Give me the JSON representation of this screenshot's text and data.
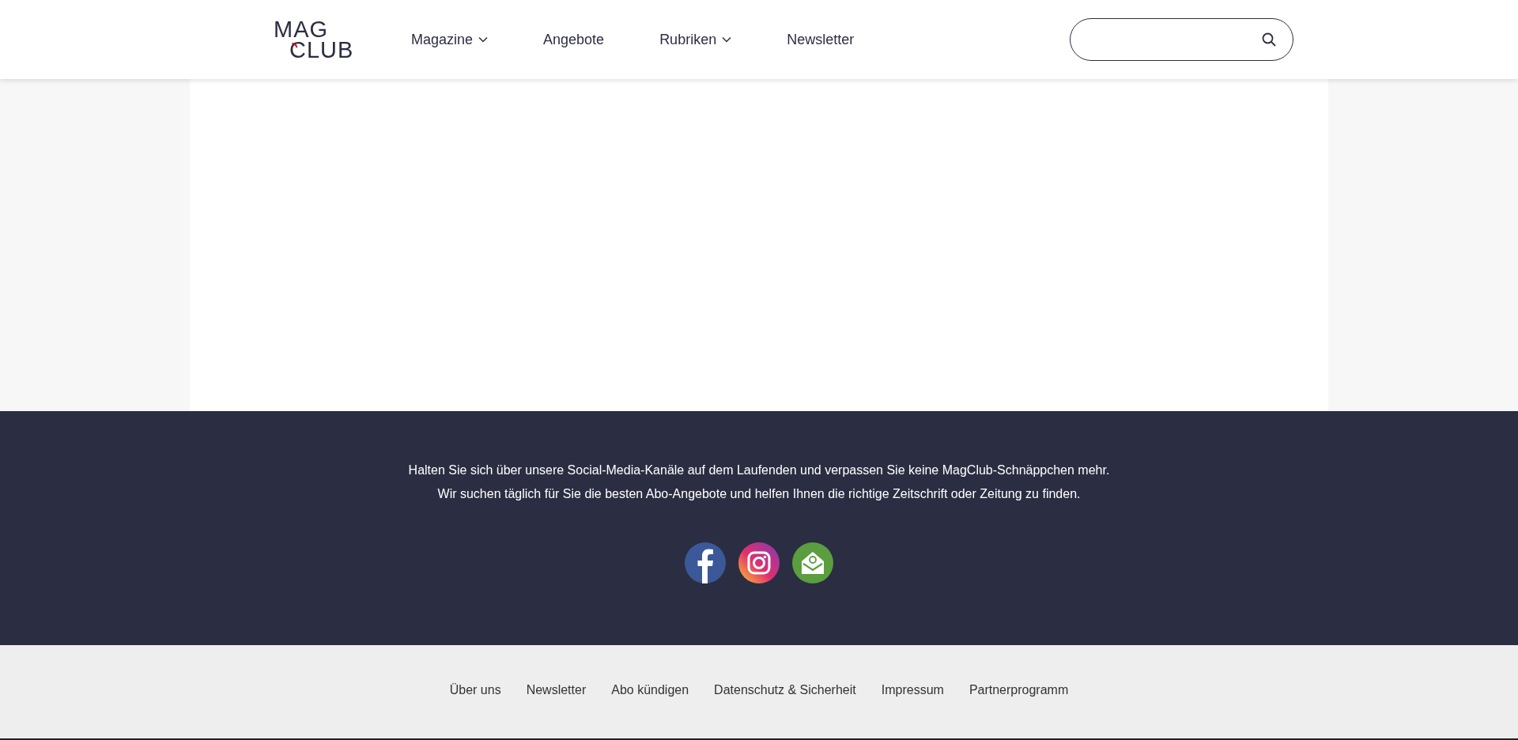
{
  "logo": {
    "top": "MAG",
    "bottom": "CLUB"
  },
  "nav": [
    {
      "label": "Magazine",
      "dropdown": true
    },
    {
      "label": "Angebote",
      "dropdown": false
    },
    {
      "label": "Rubriken",
      "dropdown": true
    },
    {
      "label": "Newsletter",
      "dropdown": false
    }
  ],
  "footer": {
    "lines": [
      "Halten Sie sich über unsere Social-Media-Kanäle auf dem Laufenden und verpassen Sie keine MagClub-Schnäppchen mehr.",
      "Wir suchen täglich für Sie die besten Abo-Angebote und helfen Ihnen die richtige Zeitschrift oder Zeitung zu finden."
    ],
    "social": [
      {
        "kind": "facebook"
      },
      {
        "kind": "instagram"
      },
      {
        "kind": "email"
      }
    ]
  },
  "bottom_links": [
    "Über uns",
    "Newsletter",
    "Abo kündigen",
    "Datenschutz & Sicherheit",
    "Impressum",
    "Partnerprogramm"
  ]
}
